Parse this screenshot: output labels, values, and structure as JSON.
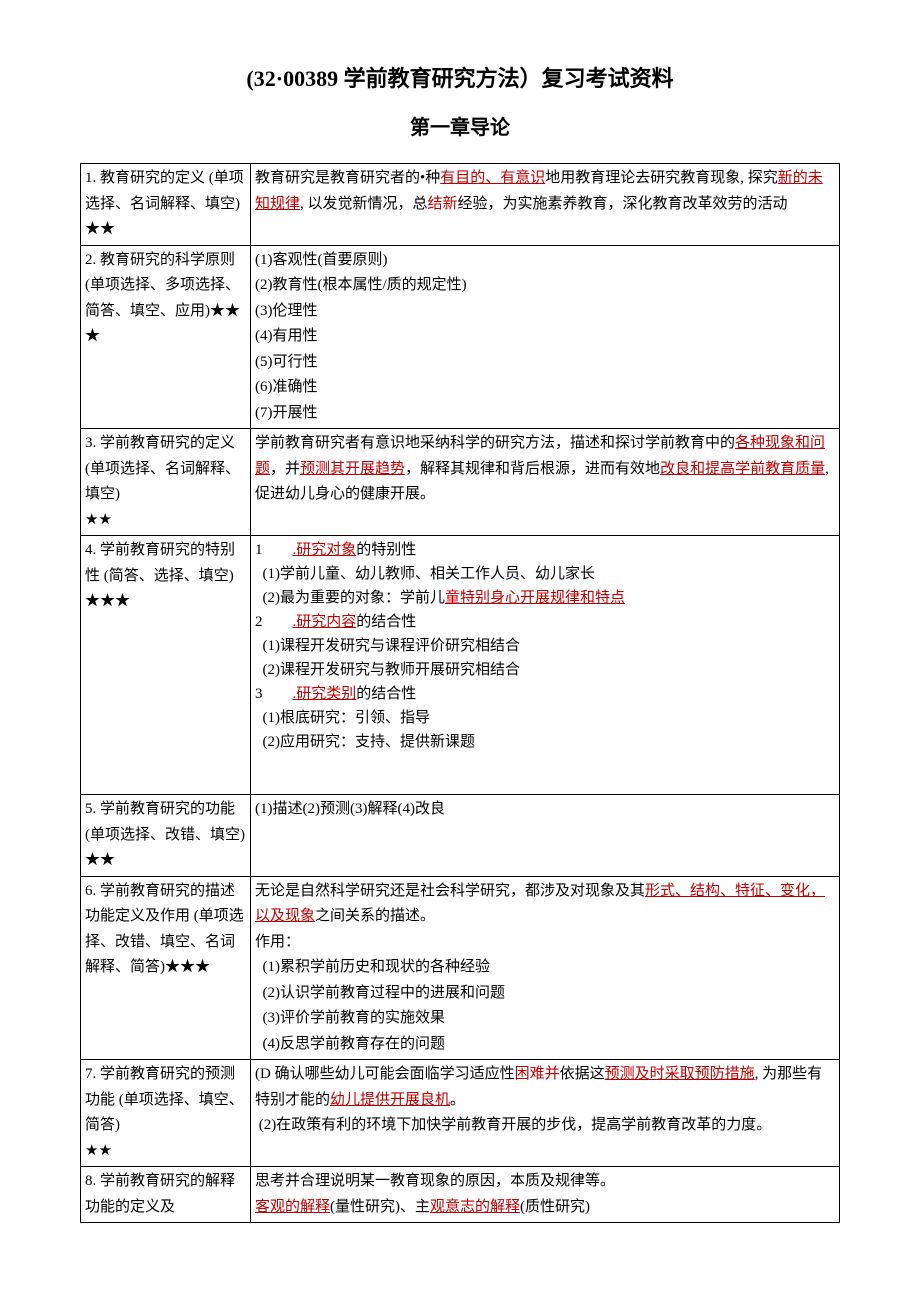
{
  "title": "(32·00389 学前教育研究方法）复习考试资料",
  "subtitle": "第一章导论",
  "rows": [
    {
      "label": "1. 教育研究的定义 (单项选择、名词解释、填空)★★",
      "htmlParts": [
        {
          "t": "教育研究是教育研究者的•种"
        },
        {
          "t": "有目的、有意识",
          "cls": "u"
        },
        {
          "t": "地用教育理论去研究教育现象, 探究"
        },
        {
          "t": "新的未知规律",
          "cls": "u"
        },
        {
          "t": ", 以发觉新情况，总"
        },
        {
          "t": "结新",
          "cls": "red"
        },
        {
          "t": "经验，为实施素养教育，深化教育改革效劳的活动"
        }
      ]
    },
    {
      "label": "2. 教育研究的科学原则 (单项选择、多项选择、简答、填空、应用)★★★",
      "lines": [
        "(1)客观性(首要原则)",
        "(2)教育性(根本属性/质的规定性)",
        "(3)伦理性",
        "(4)有用性",
        "(5)可行性",
        "(6)准确性",
        "(7)开展性"
      ],
      "cut": true
    },
    {
      "label": "3. 学前教育研究的定义 (单项选择、名词解释、填空)\n★★",
      "htmlParts": [
        {
          "t": "学前教育研究者有意识地采纳科学的研究方法，描述和探讨学前教育中的"
        },
        {
          "t": "各种现象和问题",
          "cls": "u"
        },
        {
          "t": "，并"
        },
        {
          "t": "预测其开展趋势",
          "cls": "u"
        },
        {
          "t": "，解释其规律和背后根源，进而有效地"
        },
        {
          "t": "改良和提高学前教育质量",
          "cls": "u"
        },
        {
          "t": ", 促进幼儿身心的健康开展。"
        }
      ]
    },
    {
      "label": "4. 学前教育研究的特别性 (简答、选择、填空)★★★",
      "complex4": true
    },
    {
      "label": "5. 学前教育研究的功能 (单项选择、改错、填空)★★",
      "lines": [
        "(1)描述(2)预测(3)解释(4)改良"
      ]
    },
    {
      "label": "6. 学前教育研究的描述功能定义及作用 (单项选择、改错、填空、名词解释、简答)★★★",
      "complex6": true
    },
    {
      "label": "7. 学前教育研究的预测功能 (单项选择、填空、简答)\n★★",
      "complex7": true
    },
    {
      "label": "8. 学前教育研究的解释功能的定义及",
      "complex8": true
    }
  ],
  "row4": {
    "h1a": "1",
    "h1b": ".研究对象",
    "h1c": "的特别性",
    "l1": "(1)学前儿童、幼儿教师、相关工作人员、幼儿家长",
    "l2a": "(2)最为重要的对象：学前儿",
    "l2b": "童特别身心开展规律和特点",
    "h2a": "2",
    "h2b": ".研究内容",
    "h2c": "的结合性",
    "l3": "(1)课程开发研究与课程评价研究相结合",
    "l4": "(2)课程开发研究与教师开展研究相结合",
    "h3a": "3",
    "h3b": ".研究类别",
    "h3c": "的结合性",
    "l5": "(1)根底研究：引领、指导",
    "l6": "(2)应用研究：支持、提供新课题"
  },
  "row6": {
    "p1a": "无论是自然科学研究还是社会科学研究，都涉及对现象及其",
    "p1b": "形式、结构、特征、变化，以及现象",
    "p1c": "之间关系的描述。",
    "p2": "作用：",
    "l1": "(1)累积学前历史和现状的各种经验",
    "l2": "(2)认识学前教育过程中的进展和问题",
    "l3": "(3)评价学前教育的实施效果",
    "l4": "(4)反思学前教育存在的问题"
  },
  "row7": {
    "p1a": "(D 确认哪些幼儿可能会面临学习适应性",
    "p1b": "困难并",
    "p1c": "依据这",
    "p1d": "预测及时采取预防措施",
    "p1e": ", 为那些有特别才能的",
    "p1f": "幼儿提供开展良机",
    "p1g": "。",
    "p2": "(2)在政策有利的环境下加快学前教育开展的步伐，提高学前教育改革的力度。"
  },
  "row8": {
    "p1": "思考并合理说明某一教育现象的原因，本质及规律等。",
    "p2a": "客观的解释",
    "p2b": "(量性研究)、主",
    "p2c": "观意志的解释",
    "p2d": "(质性研究)"
  }
}
